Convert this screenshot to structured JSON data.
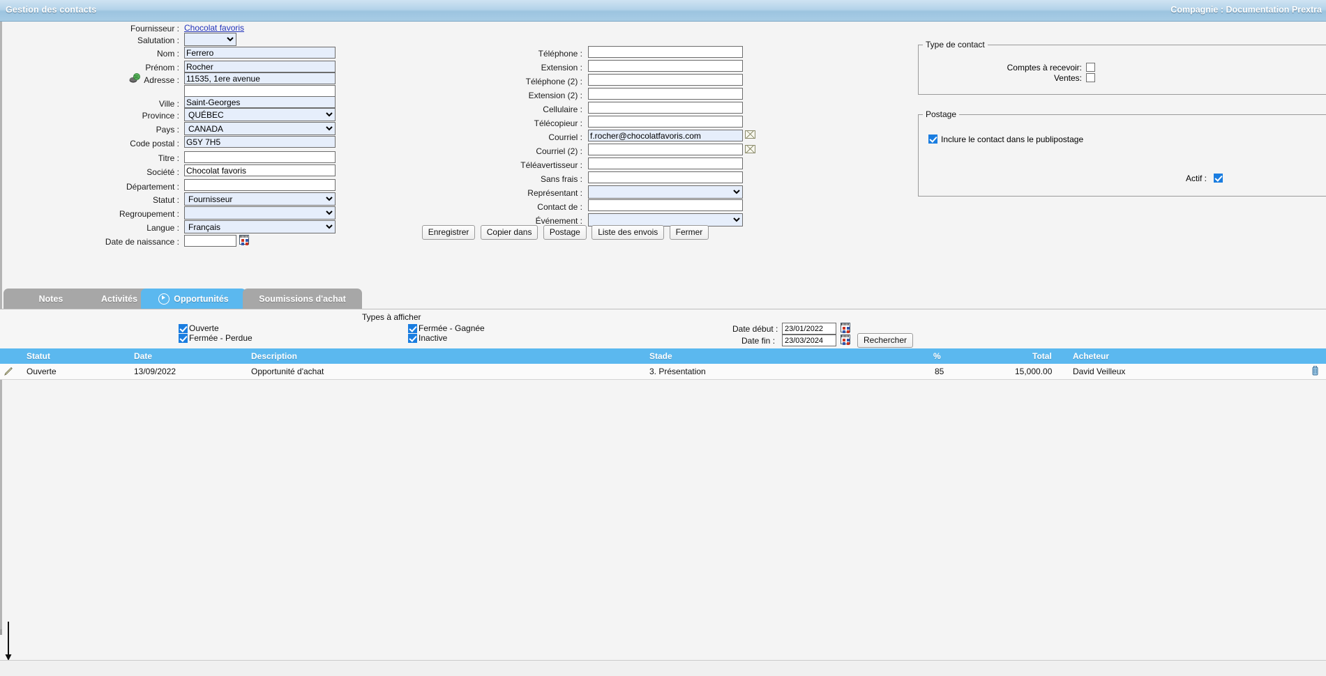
{
  "window": {
    "title": "Gestion des contacts",
    "company_label": "Compagnie : Documentation Prextra"
  },
  "contact_form": {
    "supplier": {
      "label": "Fournisseur :",
      "value": "Chocolat favoris"
    },
    "fields": [
      {
        "label": "Salutation :",
        "value": "",
        "type": "select"
      },
      {
        "label": "Nom :",
        "value": "Ferrero",
        "type": "text"
      },
      {
        "label": "Prénom :",
        "value": "Rocher",
        "type": "text"
      },
      {
        "label": "Adresse :",
        "value": "11535, 1ere avenue",
        "type": "text"
      },
      {
        "label": "",
        "value": "",
        "type": "text"
      },
      {
        "label": "Ville :",
        "value": "Saint-Georges",
        "type": "text"
      },
      {
        "label": "Province :",
        "value": "QUÉBEC",
        "type": "select"
      },
      {
        "label": "Pays :",
        "value": "CANADA",
        "type": "select"
      },
      {
        "label": "Code postal :",
        "value": "G5Y 7H5",
        "type": "text"
      },
      {
        "label": "Titre :",
        "value": "",
        "type": "text"
      },
      {
        "label": "Société :",
        "value": "Chocolat favoris",
        "type": "text"
      },
      {
        "label": "Département :",
        "value": "",
        "type": "text"
      },
      {
        "label": "Statut :",
        "value": "Fournisseur",
        "type": "select"
      },
      {
        "label": "Regroupement :",
        "value": "",
        "type": "select"
      },
      {
        "label": "Langue :",
        "value": "Français",
        "type": "select"
      },
      {
        "label": "Date de naissance :",
        "value": "",
        "type": "date"
      }
    ],
    "contact_fields": [
      {
        "label": "Téléphone :",
        "value": "",
        "type": "text"
      },
      {
        "label": "Extension :",
        "value": "",
        "type": "text"
      },
      {
        "label": "Téléphone (2) :",
        "value": "",
        "type": "text"
      },
      {
        "label": "Extension (2) :",
        "value": "",
        "type": "text"
      },
      {
        "label": "Cellulaire :",
        "value": "",
        "type": "text"
      },
      {
        "label": "Télécopieur :",
        "value": "",
        "type": "text"
      },
      {
        "label": "Courriel :",
        "value": "f.rocher@chocolatfavoris.com",
        "type": "email"
      },
      {
        "label": "Courriel (2) :",
        "value": "",
        "type": "email"
      },
      {
        "label": "Téléavertisseur :",
        "value": "",
        "type": "text"
      },
      {
        "label": "Sans frais :",
        "value": "",
        "type": "text"
      },
      {
        "label": "Représentant :",
        "value": "",
        "type": "select"
      },
      {
        "label": "Contact de :",
        "value": "",
        "type": "text"
      },
      {
        "label": "Événement :",
        "value": "",
        "type": "select"
      }
    ]
  },
  "contact_type": {
    "legend": "Type de contact",
    "items": [
      {
        "label": "Comptes à recevoir:",
        "checked": false
      },
      {
        "label": "Ventes:",
        "checked": false
      }
    ]
  },
  "postage": {
    "legend": "Postage",
    "checkbox_label": "Inclure le contact dans le publipostage",
    "checked": true
  },
  "active": {
    "label": "Actif :",
    "checked": true
  },
  "action_buttons": [
    "Enregistrer",
    "Copier dans",
    "Postage",
    "Liste des envois",
    "Fermer"
  ],
  "tabs": [
    {
      "label": "Notes",
      "active": false
    },
    {
      "label": "Activités",
      "active": false
    },
    {
      "label": "Opportunités",
      "active": true
    },
    {
      "label": "Soumissions d'achat",
      "active": false
    }
  ],
  "filters": {
    "types_label": "Types à afficher",
    "checkboxes": [
      {
        "label": "Ouverte",
        "checked": true
      },
      {
        "label": "Fermée - Perdue",
        "checked": true
      },
      {
        "label": "Fermée - Gagnée",
        "checked": true
      },
      {
        "label": "Inactive",
        "checked": true
      }
    ],
    "date_start": {
      "label": "Date début :",
      "value": "23/01/2022"
    },
    "date_end": {
      "label": "Date fin :",
      "value": "23/03/2024"
    },
    "search_button": "Rechercher"
  },
  "grid": {
    "columns": [
      "Statut",
      "Date",
      "Description",
      "Stade",
      "%",
      "Total",
      "Acheteur"
    ],
    "rows": [
      {
        "statut": "Ouverte",
        "date": "13/09/2022",
        "description": "Opportunité d'achat",
        "stade": "3. Présentation",
        "pourcent": "85",
        "total": "15,000.00",
        "acheteur": "David Veilleux"
      }
    ]
  },
  "colors": {
    "accent": "#5bb8ef",
    "title_bar": "#a8cce5",
    "tab_inactive": "#a7a7a7",
    "field_filled": "#e6eefb"
  }
}
